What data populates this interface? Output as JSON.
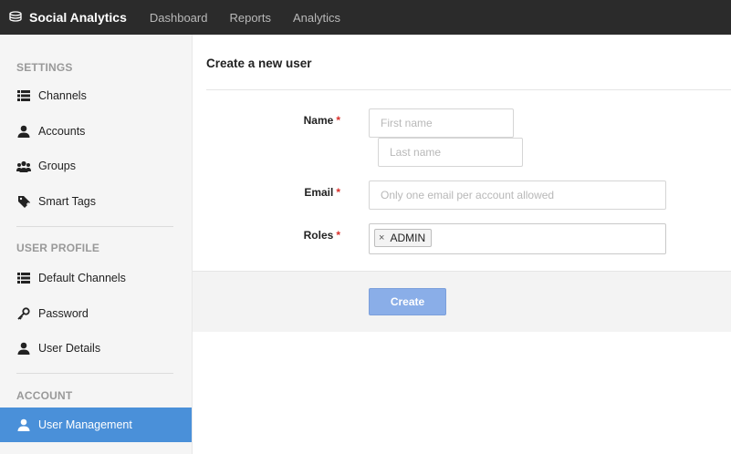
{
  "app": {
    "brand": "Social Analytics",
    "nav": [
      {
        "label": "Dashboard"
      },
      {
        "label": "Reports"
      },
      {
        "label": "Analytics"
      }
    ]
  },
  "sidebar": {
    "sections": [
      {
        "title": "SETTINGS"
      },
      {
        "title": "USER PROFILE"
      },
      {
        "title": "ACCOUNT"
      }
    ],
    "items": [
      {
        "label": "Channels",
        "icon": "list-icon"
      },
      {
        "label": "Accounts",
        "icon": "user-icon"
      },
      {
        "label": "Groups",
        "icon": "group-icon"
      },
      {
        "label": "Smart Tags",
        "icon": "tag-icon"
      },
      {
        "label": "Default Channels",
        "icon": "list-icon"
      },
      {
        "label": "Password",
        "icon": "key-icon"
      },
      {
        "label": "User Details",
        "icon": "user-icon"
      },
      {
        "label": "User Management",
        "icon": "user-icon",
        "active": true
      }
    ],
    "active_color": "#4a90d9"
  },
  "form": {
    "title": "Create a new user",
    "required_marker": "*",
    "name_label": "Name",
    "first_name_placeholder": "First name",
    "last_name_placeholder": "Last name",
    "email_label": "Email",
    "email_placeholder": "Only one email per account allowed",
    "roles_label": "Roles",
    "roles": [
      {
        "label": "ADMIN",
        "remove": "×"
      }
    ],
    "submit_label": "Create"
  }
}
